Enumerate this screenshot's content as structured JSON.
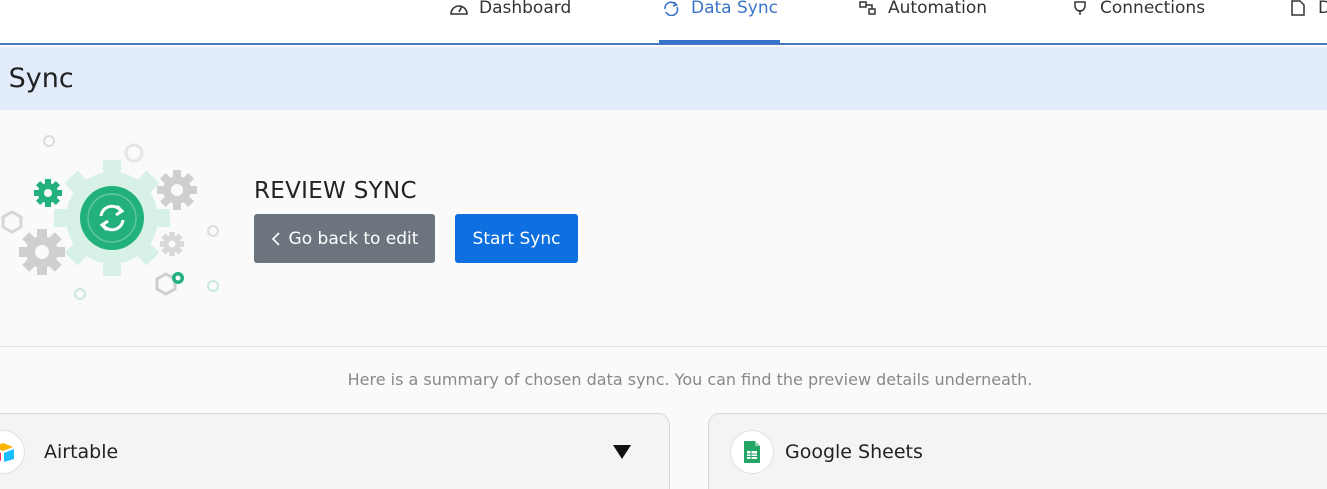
{
  "nav": {
    "items": [
      {
        "label": "Dashboard",
        "icon": "gauge-icon",
        "active": false
      },
      {
        "label": "Data Sync",
        "icon": "sync-icon",
        "active": true
      },
      {
        "label": "Automation",
        "icon": "automation-icon",
        "active": false
      },
      {
        "label": "Connections",
        "icon": "plug-icon",
        "active": false
      },
      {
        "label": "D",
        "icon": "document-icon",
        "active": false
      }
    ],
    "active_color": "#3a74c8"
  },
  "page": {
    "title": "w Sync"
  },
  "review": {
    "heading": "REVIEW SYNC",
    "back_label": "Go back to edit",
    "start_label": "Start Sync",
    "summary": "Here is a summary of chosen data sync. You can find the preview details underneath.",
    "accent_color": "#22b07d",
    "primary_color": "#0d6fe0"
  },
  "cards": {
    "source": {
      "name": "Airtable",
      "icon": "airtable-logo-icon",
      "expand_icon": "caret-down-icon"
    },
    "destination": {
      "name": "Google Sheets",
      "icon": "google-sheets-logo-icon"
    }
  }
}
